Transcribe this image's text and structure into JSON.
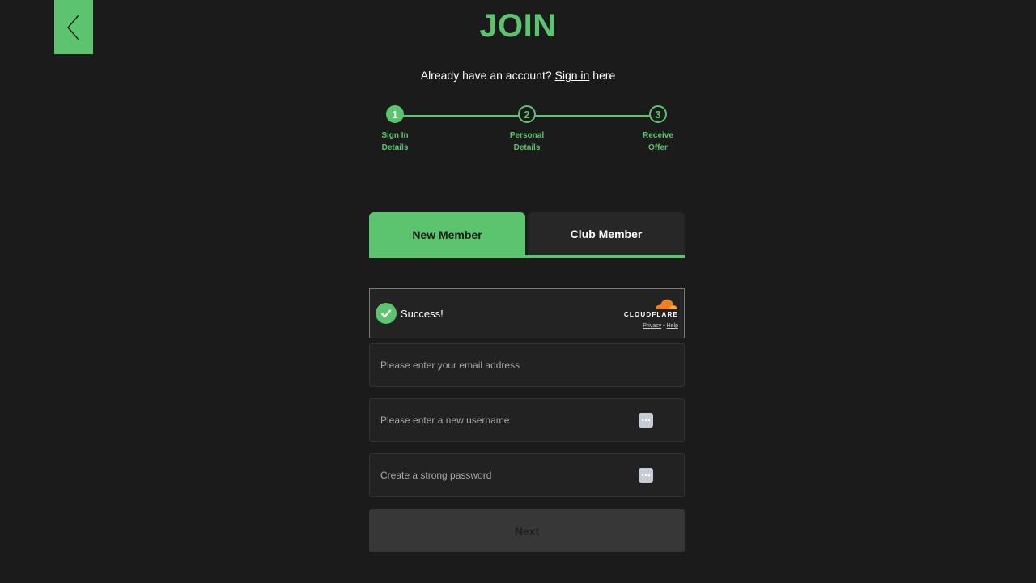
{
  "header": {
    "title": "JOIN",
    "back_icon": "chevron-left-icon"
  },
  "signin_prompt": {
    "before": "Already have an account?",
    "link": "Sign in",
    "after": "here"
  },
  "stepper": {
    "accent": "#5cc46f",
    "current_step": 1,
    "steps": [
      {
        "number": "1",
        "line1": "Sign In",
        "line2": "Details"
      },
      {
        "number": "2",
        "line1": "Personal",
        "line2": "Details"
      },
      {
        "number": "3",
        "line1": "Receive",
        "line2": "Offer"
      }
    ]
  },
  "tabs": {
    "new_member": "New Member",
    "club_member": "Club Member",
    "active": "new_member"
  },
  "captcha": {
    "status": "Success!",
    "brand": "CLOUDFLARE",
    "privacy": "Privacy",
    "separator": "•",
    "help": "Help"
  },
  "form": {
    "email_placeholder": "Please enter your email address",
    "username_placeholder": "Please enter a new username",
    "password_placeholder": "Create a strong password",
    "next_label": "Next"
  },
  "colors": {
    "accent": "#5cc46f",
    "background": "#1b1b1b",
    "cloudflare_orange": "#f38020"
  }
}
